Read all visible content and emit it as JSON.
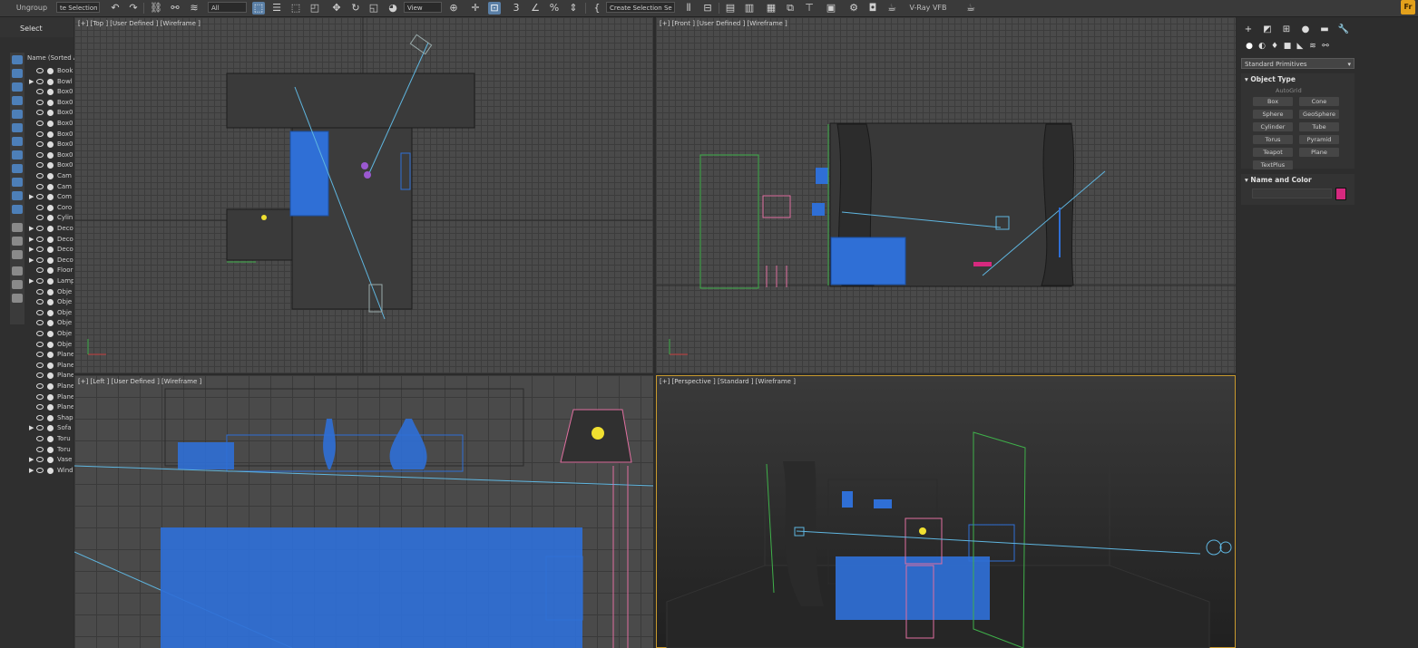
{
  "toolbar": {
    "ungroup": "Ungroup",
    "selection_set_field": "te Selection Tr",
    "filter_value": "All",
    "ref_coord_value": "View",
    "create_selection_set": "Create Selection Se",
    "vray_vfb": "V-Ray VFB",
    "fr_badge": "Fr"
  },
  "explorer": {
    "tab_label": "Select",
    "column_header": "Name (Sorted A",
    "rows": [
      {
        "name": "Book",
        "expand": false
      },
      {
        "name": "Bowl",
        "expand": true
      },
      {
        "name": "Box0",
        "expand": false
      },
      {
        "name": "Box0",
        "expand": false
      },
      {
        "name": "Box0",
        "expand": false
      },
      {
        "name": "Box0",
        "expand": false
      },
      {
        "name": "Box0",
        "expand": false
      },
      {
        "name": "Box0",
        "expand": false
      },
      {
        "name": "Box0",
        "expand": false
      },
      {
        "name": "Box0",
        "expand": false
      },
      {
        "name": "Cam",
        "expand": false
      },
      {
        "name": "Cam",
        "expand": false
      },
      {
        "name": "Com",
        "expand": true
      },
      {
        "name": "Coro",
        "expand": false
      },
      {
        "name": "Cylin",
        "expand": false
      },
      {
        "name": "Deco",
        "expand": true
      },
      {
        "name": "Deco",
        "expand": true
      },
      {
        "name": "Deco",
        "expand": true
      },
      {
        "name": "Deco",
        "expand": true
      },
      {
        "name": "Floor",
        "expand": false
      },
      {
        "name": "Lamp",
        "expand": true
      },
      {
        "name": "Obje",
        "expand": false
      },
      {
        "name": "Obje",
        "expand": false
      },
      {
        "name": "Obje",
        "expand": false
      },
      {
        "name": "Obje",
        "expand": false
      },
      {
        "name": "Obje",
        "expand": false
      },
      {
        "name": "Obje",
        "expand": false
      },
      {
        "name": "Plane",
        "expand": false
      },
      {
        "name": "Plane",
        "expand": false
      },
      {
        "name": "Plane",
        "expand": false
      },
      {
        "name": "Plane",
        "expand": false
      },
      {
        "name": "Plane",
        "expand": false
      },
      {
        "name": "Plane",
        "expand": false
      },
      {
        "name": "Shap",
        "expand": false
      },
      {
        "name": "Sofa",
        "expand": true
      },
      {
        "name": "Toru",
        "expand": false
      },
      {
        "name": "Toru",
        "expand": false
      },
      {
        "name": "Vase",
        "expand": true
      },
      {
        "name": "Wind",
        "expand": true
      }
    ]
  },
  "viewports": {
    "top": "[+] [Top ] [User Defined ] [Wireframe ]",
    "front": "[+] [Front ] [User Defined ] [Wireframe ]",
    "left": "[+] [Left ] [User Defined ] [Wireframe ]",
    "perspective": "[+] [Perspective ] [Standard ] [Wireframe ]"
  },
  "command_panel": {
    "category_dropdown": "Standard Primitives",
    "object_type_title": "Object Type",
    "autogrid": "AutoGrid",
    "primitives": [
      "Box",
      "Cone",
      "Sphere",
      "GeoSphere",
      "Cylinder",
      "Tube",
      "Torus",
      "Pyramid",
      "Teapot",
      "Plane",
      "TextPlus"
    ],
    "name_color_title": "Name and Color",
    "object_color": "#d6297f"
  },
  "colors": {
    "selection_blue": "#2f6fd6",
    "helper_cyan": "#5fb6e0",
    "camera_green": "#3fb04a",
    "lamp_pink": "#e06fa0",
    "active_viewport_border": "#c99a2e"
  }
}
